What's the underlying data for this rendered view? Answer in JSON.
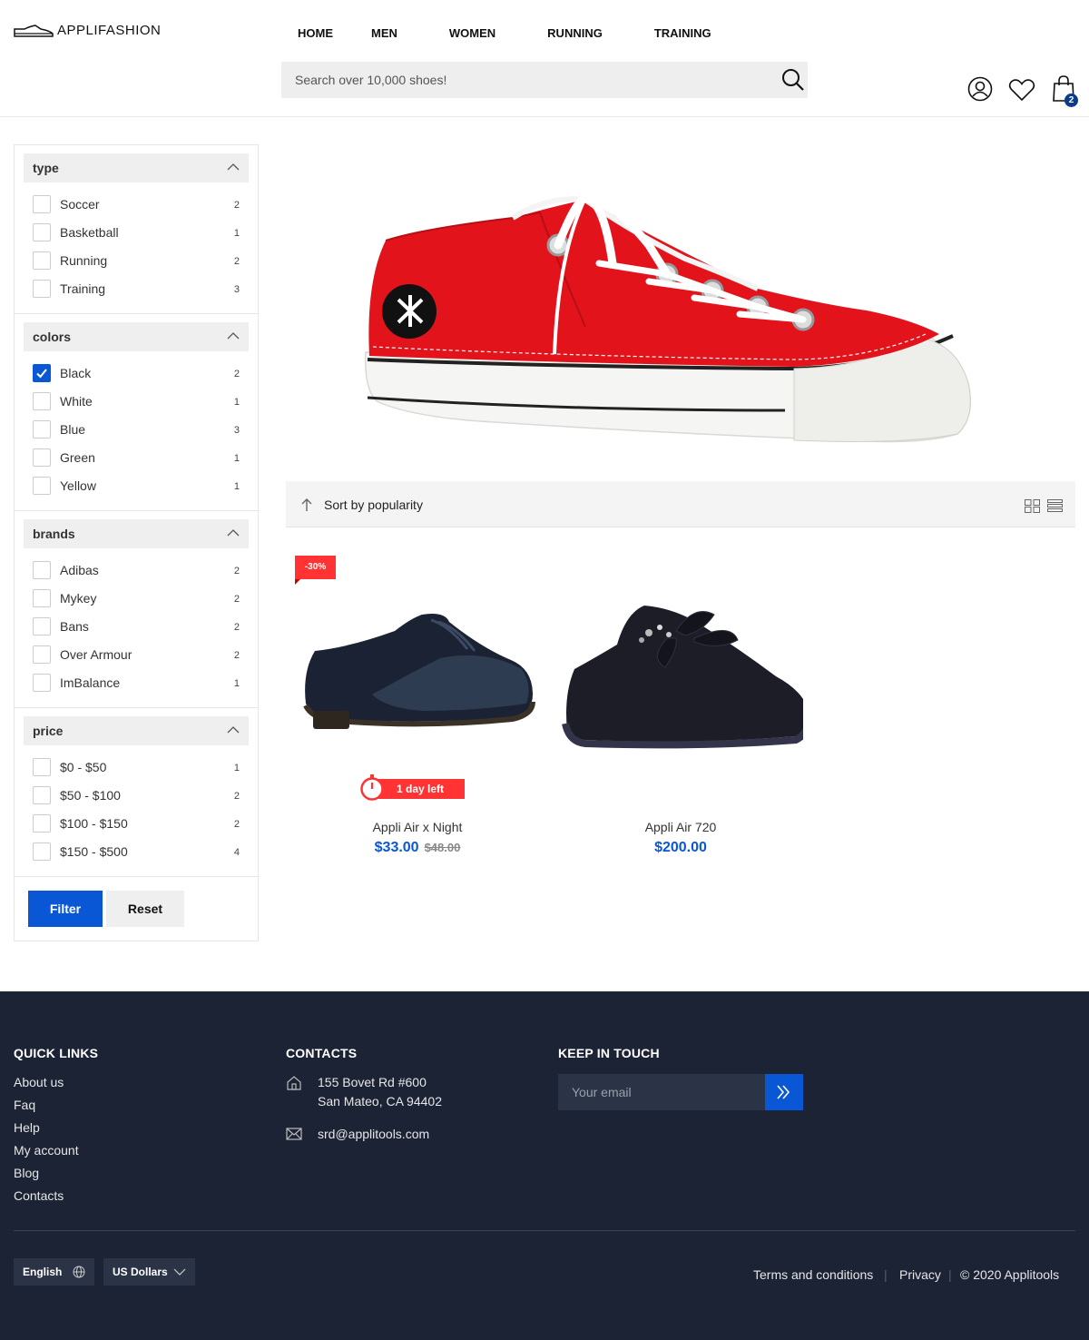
{
  "header": {
    "logo_text": "APPLIFASHION",
    "nav": [
      "HOME",
      "MEN",
      "WOMEN",
      "RUNNING",
      "TRAINING"
    ],
    "search_placeholder": "Search over 10,000 shoes!",
    "cart_count": "2",
    "icons": [
      "search-icon",
      "user-icon",
      "heart-icon",
      "cart-icon"
    ]
  },
  "filters": {
    "groups": [
      {
        "title": "type",
        "items": [
          {
            "label": "Soccer",
            "count": "2",
            "checked": false
          },
          {
            "label": "Basketball",
            "count": "1",
            "checked": false
          },
          {
            "label": "Running",
            "count": "2",
            "checked": false
          },
          {
            "label": "Training",
            "count": "3",
            "checked": false
          }
        ]
      },
      {
        "title": "colors",
        "items": [
          {
            "label": "Black",
            "count": "2",
            "checked": true
          },
          {
            "label": "White",
            "count": "1",
            "checked": false
          },
          {
            "label": "Blue",
            "count": "3",
            "checked": false
          },
          {
            "label": "Green",
            "count": "1",
            "checked": false
          },
          {
            "label": "Yellow",
            "count": "1",
            "checked": false
          }
        ]
      },
      {
        "title": "brands",
        "items": [
          {
            "label": "Adibas",
            "count": "2",
            "checked": false
          },
          {
            "label": "Mykey",
            "count": "2",
            "checked": false
          },
          {
            "label": "Bans",
            "count": "2",
            "checked": false
          },
          {
            "label": "Over Armour",
            "count": "2",
            "checked": false
          },
          {
            "label": "ImBalance",
            "count": "1",
            "checked": false
          }
        ]
      },
      {
        "title": "price",
        "items": [
          {
            "label": "$0 - $50",
            "count": "1",
            "checked": false
          },
          {
            "label": "$50 - $100",
            "count": "2",
            "checked": false
          },
          {
            "label": "$100 - $150",
            "count": "2",
            "checked": false
          },
          {
            "label": "$150 - $500",
            "count": "4",
            "checked": false
          }
        ]
      }
    ],
    "filter_label": "Filter",
    "reset_label": "Reset"
  },
  "sort": {
    "label": "Sort by popularity"
  },
  "products": [
    {
      "name": "Appli Air x Night",
      "price": "$33.00",
      "old_price": "$48.00",
      "discount": "-30%",
      "timer": "1 day left"
    },
    {
      "name": "Appli Air 720",
      "price": "$200.00"
    }
  ],
  "footer": {
    "quick_links_title": "QUICK LINKS",
    "quick_links": [
      "About us",
      "Faq",
      "Help",
      "My account",
      "Blog",
      "Contacts"
    ],
    "contacts_title": "CONTACTS",
    "address_line1": "155 Bovet Rd #600",
    "address_line2": "San Mateo, CA 94402",
    "email": "srd@applitools.com",
    "keep_title": "KEEP IN TOUCH",
    "email_placeholder": "Your email",
    "language": "English",
    "currency": "US Dollars",
    "terms": "Terms and conditions",
    "privacy": "Privacy",
    "copyright": "© 2020 Applitools"
  },
  "colors": {
    "accent": "#0a57d6",
    "sale": "#ff3333",
    "footer_bg": "#1b2335",
    "badge": "#0a3b8c"
  }
}
